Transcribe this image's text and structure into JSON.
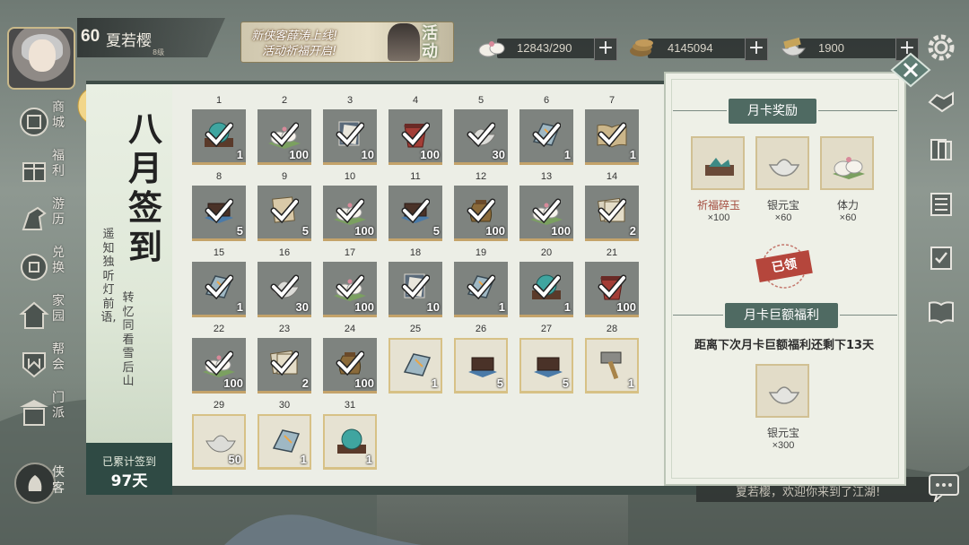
{
  "player": {
    "level": "60",
    "name": "夏若樱",
    "sub": "8级"
  },
  "event_banner": {
    "line1": "新侠客薛涛上线!",
    "line2": "活动祈福开启!",
    "tag": "活动"
  },
  "resources": [
    {
      "icon": "stamina-bun-icon",
      "value": "12843/290"
    },
    {
      "icon": "copper-coin-icon",
      "value": "4145094"
    },
    {
      "icon": "silver-ingot-icon",
      "value": "1900"
    }
  ],
  "left_nav": [
    {
      "label": "商城",
      "icon": "shop-icon"
    },
    {
      "label": "福利",
      "icon": "welfare-icon"
    },
    {
      "label": "游历",
      "icon": "horse-icon"
    },
    {
      "label": "兑换",
      "icon": "exchange-icon"
    },
    {
      "label": "家园",
      "icon": "home-icon"
    },
    {
      "label": "帮会",
      "icon": "guild-icon"
    },
    {
      "label": "门派",
      "icon": "sect-icon"
    }
  ],
  "chat_button": {
    "label": "侠客"
  },
  "bottom_message": "夏若樱，欢迎你来到了江湖!",
  "calendar": {
    "title": "八月签到",
    "poem_line1": "遥知独听灯前语,",
    "poem_line2": "转忆同看雪后山",
    "total_label": "已累计签到",
    "total_value": "97天",
    "days": [
      {
        "day": "1",
        "item": "jade-orb-icon",
        "qty": "1",
        "claimed": true
      },
      {
        "day": "2",
        "item": "stamina-bun-icon",
        "qty": "100",
        "claimed": true
      },
      {
        "day": "3",
        "item": "scroll-icon",
        "qty": "10",
        "claimed": true
      },
      {
        "day": "4",
        "item": "red-pouch-icon",
        "qty": "100",
        "claimed": true
      },
      {
        "day": "5",
        "item": "silver-ingot-icon",
        "qty": "30",
        "claimed": true
      },
      {
        "day": "6",
        "item": "whetstone-icon",
        "qty": "1",
        "claimed": true
      },
      {
        "day": "7",
        "item": "book-icon",
        "qty": "1",
        "claimed": true
      },
      {
        "day": "8",
        "item": "chest-icon",
        "qty": "5",
        "claimed": true
      },
      {
        "day": "9",
        "item": "paper-icon",
        "qty": "5",
        "claimed": true
      },
      {
        "day": "10",
        "item": "stamina-bun-icon",
        "qty": "100",
        "claimed": true
      },
      {
        "day": "11",
        "item": "chest-icon",
        "qty": "5",
        "claimed": true
      },
      {
        "day": "12",
        "item": "money-bag-icon",
        "qty": "100",
        "claimed": true
      },
      {
        "day": "13",
        "item": "stamina-bun-icon",
        "qty": "100",
        "claimed": true
      },
      {
        "day": "14",
        "item": "map-icon",
        "qty": "2",
        "claimed": true
      },
      {
        "day": "15",
        "item": "whetstone-icon",
        "qty": "1",
        "claimed": true
      },
      {
        "day": "16",
        "item": "silver-ingot-icon",
        "qty": "30",
        "claimed": true
      },
      {
        "day": "17",
        "item": "stamina-bun-icon",
        "qty": "100",
        "claimed": true
      },
      {
        "day": "18",
        "item": "scroll-icon",
        "qty": "10",
        "claimed": true
      },
      {
        "day": "19",
        "item": "whetstone-icon",
        "qty": "1",
        "claimed": true
      },
      {
        "day": "20",
        "item": "jade-orb-icon",
        "qty": "1",
        "claimed": true
      },
      {
        "day": "21",
        "item": "red-pouch-icon",
        "qty": "100",
        "claimed": true
      },
      {
        "day": "22",
        "item": "stamina-bun-icon",
        "qty": "100",
        "claimed": true
      },
      {
        "day": "23",
        "item": "map-icon",
        "qty": "2",
        "claimed": true
      },
      {
        "day": "24",
        "item": "money-bag-icon",
        "qty": "100",
        "claimed": true
      },
      {
        "day": "25",
        "item": "whetstone-icon",
        "qty": "1",
        "claimed": false
      },
      {
        "day": "26",
        "item": "chest-icon",
        "qty": "5",
        "claimed": false
      },
      {
        "day": "27",
        "item": "chest-icon",
        "qty": "5",
        "claimed": false
      },
      {
        "day": "28",
        "item": "hammer-icon",
        "qty": "1",
        "claimed": false
      },
      {
        "day": "29",
        "item": "silver-ingot-icon",
        "qty": "50",
        "claimed": false
      },
      {
        "day": "30",
        "item": "whetstone-icon",
        "qty": "1",
        "claimed": false
      },
      {
        "day": "31",
        "item": "jade-orb-icon",
        "qty": "1",
        "claimed": false
      }
    ]
  },
  "monthly_card": {
    "title": "月卡奖励",
    "rewards": [
      {
        "icon": "jade-shard-icon",
        "name": "祈福碎玉",
        "count": "×100"
      },
      {
        "icon": "silver-ingot-icon",
        "name": "银元宝",
        "count": "×60"
      },
      {
        "icon": "stamina-bun-icon",
        "name": "体力",
        "count": "×60"
      }
    ],
    "claimed_stamp": "已领",
    "big_title": "月卡巨额福利",
    "big_note": "距离下次月卡巨额福利还剩下13天",
    "big_reward": {
      "icon": "silver-ingot-icon",
      "name": "银元宝",
      "count": "×300"
    }
  },
  "colors": {
    "panel_dark": "#2f4a44",
    "header_green": "#4f6a62",
    "stamp_red": "#b5463c",
    "gold_border": "#d1c093"
  }
}
